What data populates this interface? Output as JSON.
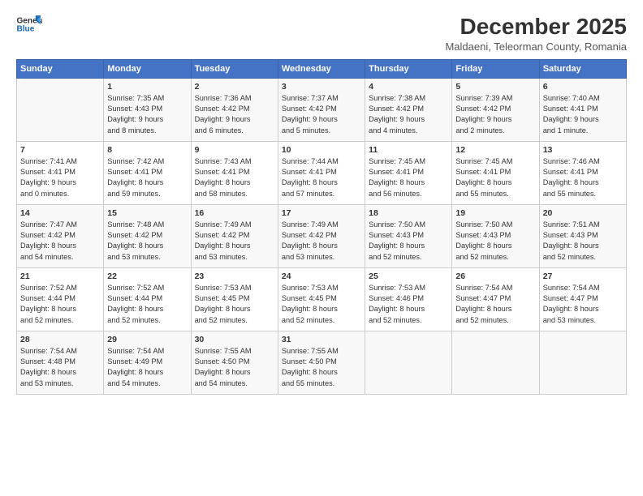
{
  "header": {
    "logo_line1": "General",
    "logo_line2": "Blue",
    "title": "December 2025",
    "subtitle": "Maldaeni, Teleorman County, Romania"
  },
  "days_of_week": [
    "Sunday",
    "Monday",
    "Tuesday",
    "Wednesday",
    "Thursday",
    "Friday",
    "Saturday"
  ],
  "weeks": [
    [
      {
        "day": "",
        "info": ""
      },
      {
        "day": "1",
        "info": "Sunrise: 7:35 AM\nSunset: 4:43 PM\nDaylight: 9 hours\nand 8 minutes."
      },
      {
        "day": "2",
        "info": "Sunrise: 7:36 AM\nSunset: 4:42 PM\nDaylight: 9 hours\nand 6 minutes."
      },
      {
        "day": "3",
        "info": "Sunrise: 7:37 AM\nSunset: 4:42 PM\nDaylight: 9 hours\nand 5 minutes."
      },
      {
        "day": "4",
        "info": "Sunrise: 7:38 AM\nSunset: 4:42 PM\nDaylight: 9 hours\nand 4 minutes."
      },
      {
        "day": "5",
        "info": "Sunrise: 7:39 AM\nSunset: 4:42 PM\nDaylight: 9 hours\nand 2 minutes."
      },
      {
        "day": "6",
        "info": "Sunrise: 7:40 AM\nSunset: 4:41 PM\nDaylight: 9 hours\nand 1 minute."
      }
    ],
    [
      {
        "day": "7",
        "info": "Sunrise: 7:41 AM\nSunset: 4:41 PM\nDaylight: 9 hours\nand 0 minutes."
      },
      {
        "day": "8",
        "info": "Sunrise: 7:42 AM\nSunset: 4:41 PM\nDaylight: 8 hours\nand 59 minutes."
      },
      {
        "day": "9",
        "info": "Sunrise: 7:43 AM\nSunset: 4:41 PM\nDaylight: 8 hours\nand 58 minutes."
      },
      {
        "day": "10",
        "info": "Sunrise: 7:44 AM\nSunset: 4:41 PM\nDaylight: 8 hours\nand 57 minutes."
      },
      {
        "day": "11",
        "info": "Sunrise: 7:45 AM\nSunset: 4:41 PM\nDaylight: 8 hours\nand 56 minutes."
      },
      {
        "day": "12",
        "info": "Sunrise: 7:45 AM\nSunset: 4:41 PM\nDaylight: 8 hours\nand 55 minutes."
      },
      {
        "day": "13",
        "info": "Sunrise: 7:46 AM\nSunset: 4:41 PM\nDaylight: 8 hours\nand 55 minutes."
      }
    ],
    [
      {
        "day": "14",
        "info": "Sunrise: 7:47 AM\nSunset: 4:42 PM\nDaylight: 8 hours\nand 54 minutes."
      },
      {
        "day": "15",
        "info": "Sunrise: 7:48 AM\nSunset: 4:42 PM\nDaylight: 8 hours\nand 53 minutes."
      },
      {
        "day": "16",
        "info": "Sunrise: 7:49 AM\nSunset: 4:42 PM\nDaylight: 8 hours\nand 53 minutes."
      },
      {
        "day": "17",
        "info": "Sunrise: 7:49 AM\nSunset: 4:42 PM\nDaylight: 8 hours\nand 53 minutes."
      },
      {
        "day": "18",
        "info": "Sunrise: 7:50 AM\nSunset: 4:43 PM\nDaylight: 8 hours\nand 52 minutes."
      },
      {
        "day": "19",
        "info": "Sunrise: 7:50 AM\nSunset: 4:43 PM\nDaylight: 8 hours\nand 52 minutes."
      },
      {
        "day": "20",
        "info": "Sunrise: 7:51 AM\nSunset: 4:43 PM\nDaylight: 8 hours\nand 52 minutes."
      }
    ],
    [
      {
        "day": "21",
        "info": "Sunrise: 7:52 AM\nSunset: 4:44 PM\nDaylight: 8 hours\nand 52 minutes."
      },
      {
        "day": "22",
        "info": "Sunrise: 7:52 AM\nSunset: 4:44 PM\nDaylight: 8 hours\nand 52 minutes."
      },
      {
        "day": "23",
        "info": "Sunrise: 7:53 AM\nSunset: 4:45 PM\nDaylight: 8 hours\nand 52 minutes."
      },
      {
        "day": "24",
        "info": "Sunrise: 7:53 AM\nSunset: 4:45 PM\nDaylight: 8 hours\nand 52 minutes."
      },
      {
        "day": "25",
        "info": "Sunrise: 7:53 AM\nSunset: 4:46 PM\nDaylight: 8 hours\nand 52 minutes."
      },
      {
        "day": "26",
        "info": "Sunrise: 7:54 AM\nSunset: 4:47 PM\nDaylight: 8 hours\nand 52 minutes."
      },
      {
        "day": "27",
        "info": "Sunrise: 7:54 AM\nSunset: 4:47 PM\nDaylight: 8 hours\nand 53 minutes."
      }
    ],
    [
      {
        "day": "28",
        "info": "Sunrise: 7:54 AM\nSunset: 4:48 PM\nDaylight: 8 hours\nand 53 minutes."
      },
      {
        "day": "29",
        "info": "Sunrise: 7:54 AM\nSunset: 4:49 PM\nDaylight: 8 hours\nand 54 minutes."
      },
      {
        "day": "30",
        "info": "Sunrise: 7:55 AM\nSunset: 4:50 PM\nDaylight: 8 hours\nand 54 minutes."
      },
      {
        "day": "31",
        "info": "Sunrise: 7:55 AM\nSunset: 4:50 PM\nDaylight: 8 hours\nand 55 minutes."
      },
      {
        "day": "",
        "info": ""
      },
      {
        "day": "",
        "info": ""
      },
      {
        "day": "",
        "info": ""
      }
    ]
  ]
}
